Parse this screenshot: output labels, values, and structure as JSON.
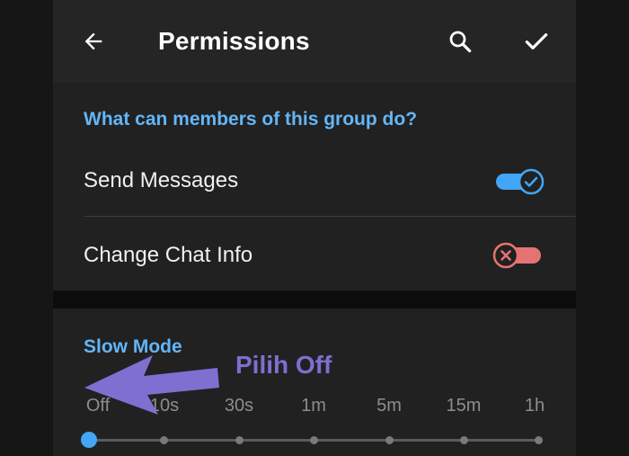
{
  "header": {
    "title": "Permissions",
    "back_icon": "arrow-back-icon",
    "search_icon": "search-icon",
    "done_icon": "check-icon"
  },
  "permissions": {
    "section_title": "What can members of this group do?",
    "items": [
      {
        "label": "Send Messages",
        "enabled": true
      },
      {
        "label": "Change Chat Info",
        "enabled": false
      }
    ]
  },
  "slow_mode": {
    "section_title": "Slow Mode",
    "options": [
      "Off",
      "10s",
      "30s",
      "1m",
      "5m",
      "15m",
      "1h"
    ],
    "selected": "Off"
  },
  "annotation": {
    "text": "Pilih Off"
  },
  "colors": {
    "accent": "#64b5f6",
    "toggle_on": "#42a5f5",
    "toggle_off": "#e57373",
    "annotation": "#7e6fd0"
  }
}
